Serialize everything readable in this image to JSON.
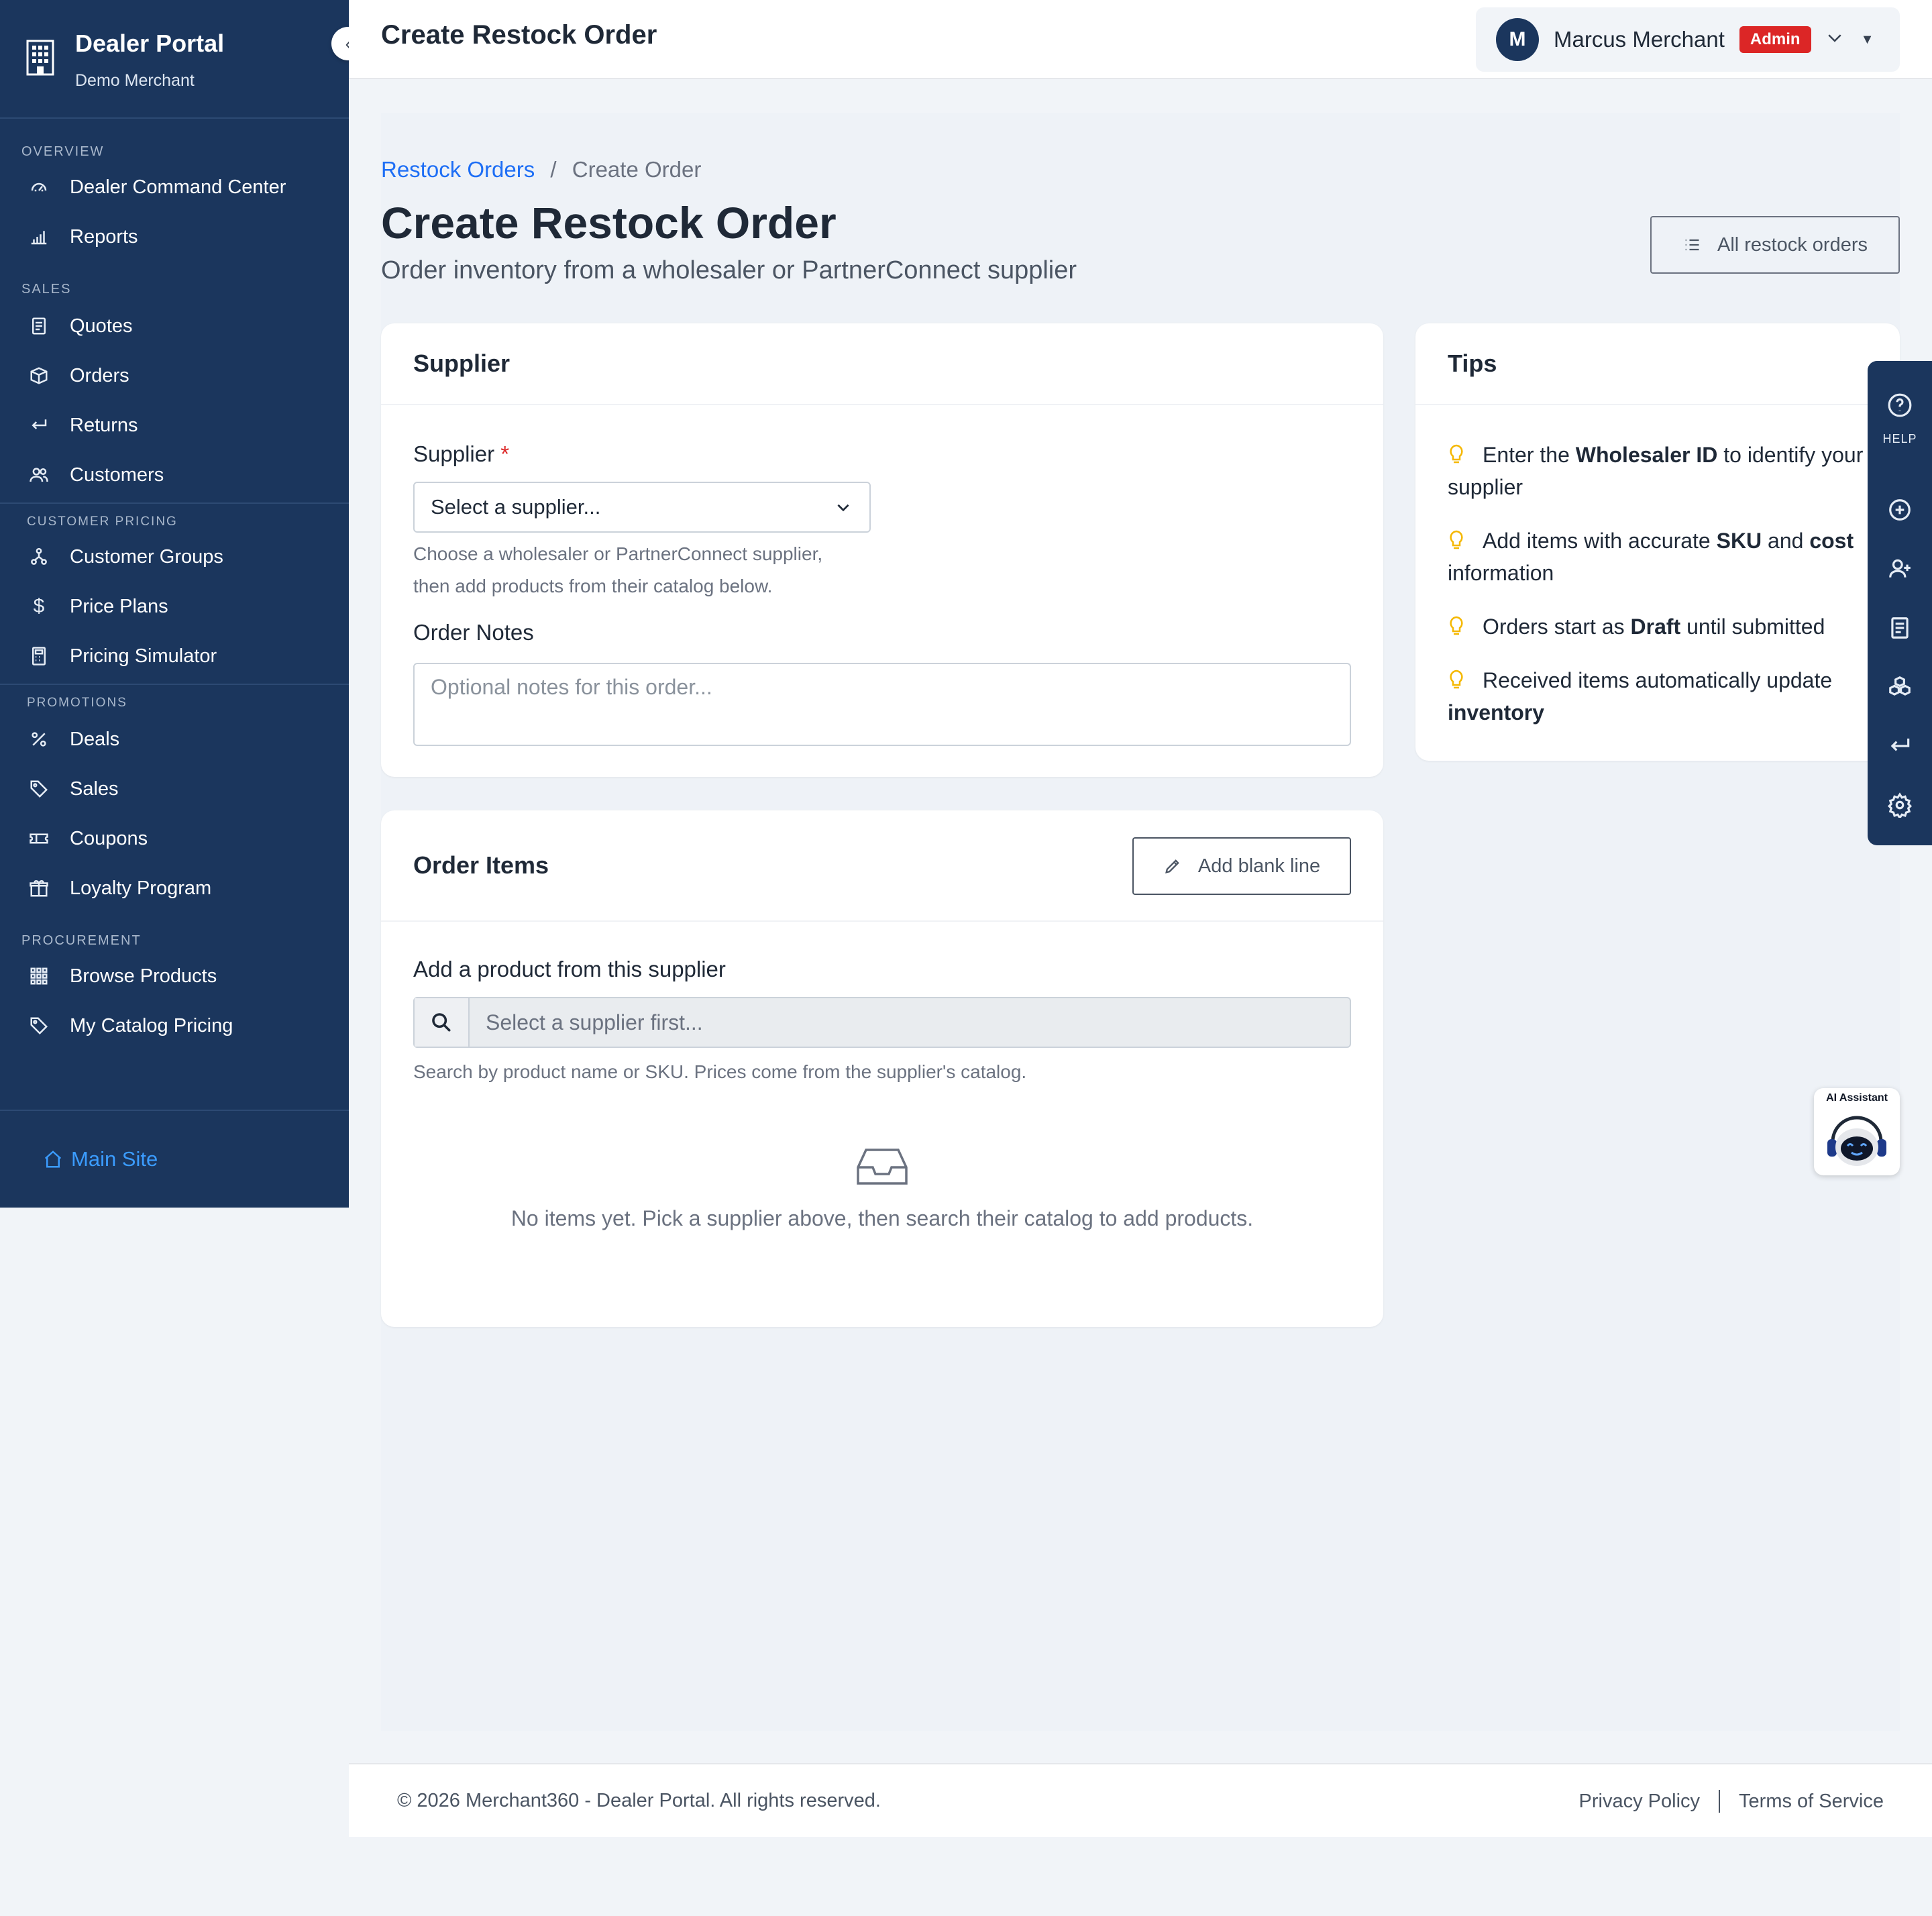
{
  "sidebar": {
    "brand_title": "Dealer Portal",
    "brand_subtitle": "Demo Merchant",
    "sections": {
      "overview": "OVERVIEW",
      "sales": "SALES",
      "customer_pricing": "CUSTOMER PRICING",
      "promotions": "PROMOTIONS",
      "procurement": "PROCUREMENT"
    },
    "items": {
      "dealer_command_center": "Dealer Command Center",
      "reports": "Reports",
      "quotes": "Quotes",
      "orders": "Orders",
      "returns": "Returns",
      "customers": "Customers",
      "customer_groups": "Customer Groups",
      "price_plans": "Price Plans",
      "pricing_simulator": "Pricing Simulator",
      "deals": "Deals",
      "sales": "Sales",
      "coupons": "Coupons",
      "loyalty_program": "Loyalty Program",
      "browse_products": "Browse Products",
      "my_catalog_pricing": "My Catalog Pricing"
    },
    "main_site": "Main Site"
  },
  "header": {
    "title": "Create Restock Order",
    "user": {
      "initial": "M",
      "name": "Marcus Merchant",
      "role_badge": "Admin"
    }
  },
  "breadcrumb": {
    "parent": "Restock Orders",
    "separator": "/",
    "current": "Create Order"
  },
  "page": {
    "title": "Create Restock Order",
    "subtitle": "Order inventory from a wholesaler or PartnerConnect supplier",
    "all_orders_button": "All restock orders"
  },
  "supplier_card": {
    "title": "Supplier",
    "supplier_label": "Supplier",
    "required_mark": "*",
    "supplier_select_value": "Select a supplier...",
    "supplier_help_line1": "Choose a wholesaler or PartnerConnect supplier,",
    "supplier_help_line2": "then add products from their catalog below.",
    "notes_label": "Order Notes",
    "notes_placeholder": "Optional notes for this order..."
  },
  "items_card": {
    "title": "Order Items",
    "add_blank_line": "Add blank line",
    "search_label": "Add a product from this supplier",
    "search_placeholder": "Select a supplier first...",
    "search_help": "Search by product name or SKU. Prices come from the supplier's catalog.",
    "empty_text": "No items yet. Pick a supplier above, then search their catalog to add products."
  },
  "tips_card": {
    "title": "Tips",
    "tips": [
      {
        "pre": "Enter the ",
        "bold": "Wholesaler ID",
        "post": " to identify your supplier"
      },
      {
        "pre": "Add items with accurate ",
        "bold": "SKU",
        "mid": " and ",
        "bold2": "cost",
        "post": " information"
      },
      {
        "pre": "Orders start as ",
        "bold": "Draft",
        "post": " until submitted"
      },
      {
        "pre": "Received items automatically update ",
        "bold": "inventory",
        "post": ""
      }
    ]
  },
  "help_rail": {
    "help_label": "HELP",
    "icons": [
      "help-circle-icon",
      "plus-circle-icon",
      "user-plus-icon",
      "document-icon",
      "boxes-icon",
      "return-icon",
      "gear-icon"
    ]
  },
  "ai_assistant": {
    "label": "AI Assistant"
  },
  "footer": {
    "copyright": "© 2026 Merchant360 - Dealer Portal. All rights reserved.",
    "privacy": "Privacy Policy",
    "terms": "Terms of Service"
  },
  "colors": {
    "sidebar_bg": "#1b365d",
    "link_blue": "#1d6ef5",
    "admin_badge": "#dc2626",
    "tip_bulb": "#f5b800"
  }
}
